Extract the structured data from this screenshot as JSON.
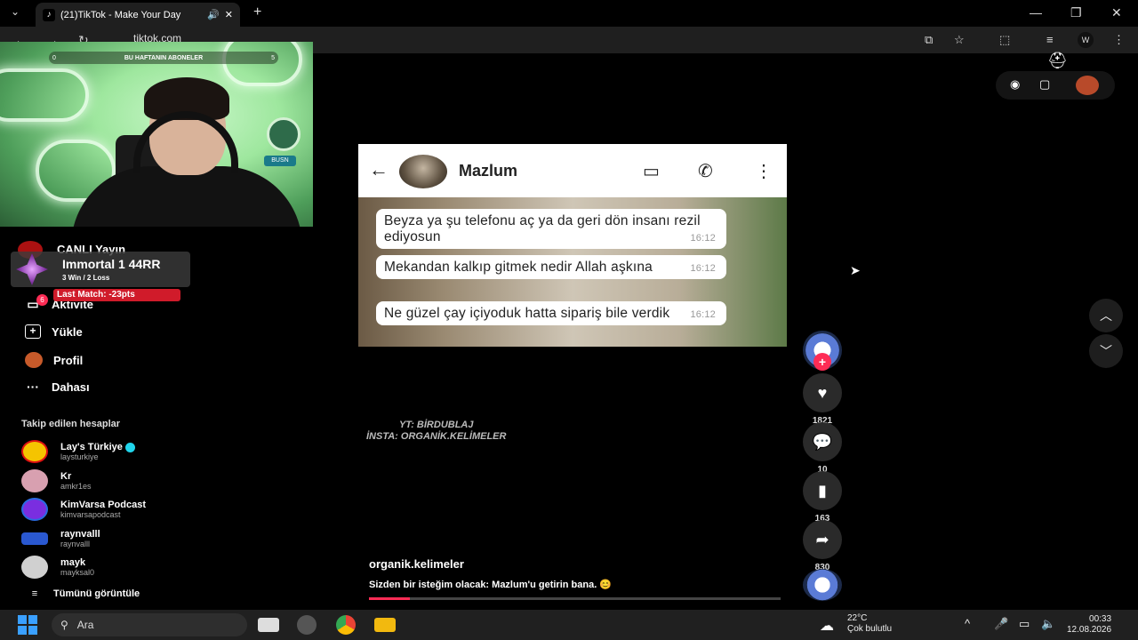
{
  "browser": {
    "tab_title": "(21)TikTok - Make Your Day",
    "url": "tiktok.com",
    "minimize": "—",
    "restore": "❐",
    "close": "✕",
    "new_tab": "+",
    "tab_close": "✕"
  },
  "webcam": {
    "sub_bar_left": "0",
    "sub_bar_title": "BU HAFTANIN ABONELER",
    "sub_bar_right": "5",
    "badge_text": "BUSN"
  },
  "sidebar": {
    "live_label": "CANLI Yayın",
    "rank_name": "Immortal 1  44RR",
    "rank_sub": "3 Win / 2 Loss",
    "last_match": "Last Match: -23pts",
    "items": [
      {
        "label": "Aktivite",
        "icon": "inbox-icon",
        "glyph": "▭",
        "badge": "6"
      },
      {
        "label": "Yükle",
        "icon": "upload-icon",
        "glyph": "⊞"
      },
      {
        "label": "Profil",
        "icon": "profile-icon",
        "glyph": "●"
      },
      {
        "label": "Dahası",
        "icon": "more-icon",
        "glyph": "···"
      }
    ],
    "following_header": "Takip edilen hesaplar",
    "following": [
      {
        "name": "Lay's Türkiye",
        "handle": "laysturkiye",
        "verified": true,
        "color": "#f5c400"
      },
      {
        "name": "Kr",
        "handle": "amkr1es",
        "verified": false,
        "color": "#d8a0b0"
      },
      {
        "name": "KimVarsa Podcast",
        "handle": "kimvarsapodcast",
        "verified": false,
        "color": "#7a2ee0"
      },
      {
        "name": "raynvalll",
        "handle": "raynvalll",
        "verified": false,
        "color": "#2a58d0"
      },
      {
        "name": "mayk",
        "handle": "mayksal0",
        "verified": false,
        "color": "#d0d0d0"
      }
    ],
    "see_all": "Tümünü görüntüle"
  },
  "video": {
    "contact_name": "Mazlum",
    "messages": [
      {
        "text": "Beyza ya şu telefonu aç ya da geri dön insanı rezil ediyosun",
        "time": "16:12"
      },
      {
        "text": "Mekandan kalkıp gitmek nedir Allah aşkına",
        "time": "16:12"
      },
      {
        "text": "Ne güzel çay içiyoduk hatta sipariş bile verdik",
        "time": "16:12"
      }
    ],
    "watermark_line1": "YT: BİRDUBLAJ",
    "watermark_line2": "İNSTA: ORGANİK.KELİMELER",
    "author": "organik.kelimeler",
    "caption": "Sizden bir isteğim olacak: Mazlum'u getirin bana. 😊",
    "progress": 0.1
  },
  "actions": {
    "likes": "1821",
    "comments": "10",
    "saves": "163",
    "shares": "830"
  },
  "taskbar": {
    "search_placeholder": "Ara",
    "temperature": "22°C",
    "weather": "Çok bulutlu",
    "time": "00:33",
    "date": "12.08.2026"
  }
}
